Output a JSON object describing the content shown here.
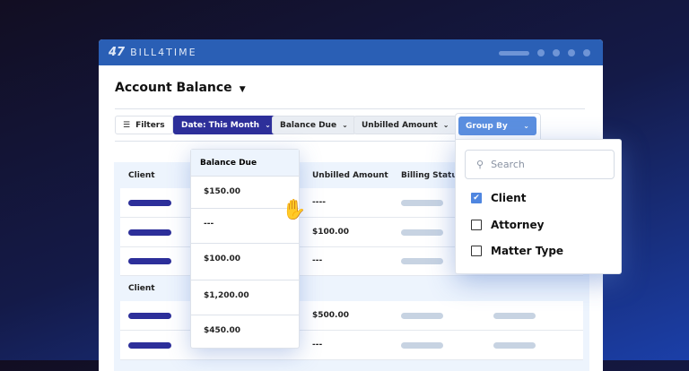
{
  "app": {
    "brand": "BILL4TIME",
    "logo_mark": "47"
  },
  "page": {
    "title": "Account Balance"
  },
  "toolbar": {
    "filters": "Filters",
    "date": "Date: This Month",
    "balance_due": "Balance Due",
    "unbilled_amount": "Unbilled Amount",
    "group_by": "Group By"
  },
  "table": {
    "headers": [
      "Client",
      "Unbilled Amount",
      "Billing Status"
    ],
    "group_label": "Client",
    "unbilled": [
      "----",
      "$100.00",
      "---",
      "$500.00",
      "---"
    ]
  },
  "balance_column": {
    "header": "Balance Due",
    "values": [
      "$150.00",
      "---",
      "$100.00",
      "$1,200.00",
      "$450.00"
    ]
  },
  "group_panel": {
    "search_placeholder": "Search",
    "options": [
      {
        "label": "Client",
        "checked": true
      },
      {
        "label": "Attorney",
        "checked": false
      },
      {
        "label": "Matter Type",
        "checked": false
      }
    ]
  },
  "colors": {
    "titlebar": "#2a5fb5",
    "accent_dark": "#2d2f9a",
    "accent_light": "#5b8fe0"
  }
}
